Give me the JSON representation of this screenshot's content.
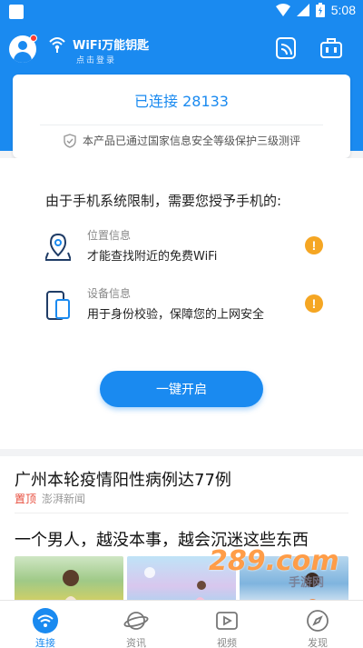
{
  "status_bar": {
    "time": "5:08"
  },
  "header": {
    "brand_name": "WiFi万能钥匙",
    "login_hint": "点击登录",
    "icons": [
      "avatar",
      "wifi-logo-icon",
      "scan-icon",
      "toolbox-icon"
    ]
  },
  "connection_card": {
    "status": "已连接 28133",
    "security_note": "本产品已通过国家信息安全等级保护三级测评"
  },
  "permissions": {
    "title": "由于手机系统限制，需要您授予手机的:",
    "items": [
      {
        "label": "位置信息",
        "description": "才能查找附近的免费WiFi",
        "icon": "location-icon"
      },
      {
        "label": "设备信息",
        "description": "用于身份校验，保障您的上网安全",
        "icon": "device-icon"
      }
    ],
    "enable_button": "一键开启"
  },
  "feed": {
    "items": [
      {
        "title": "广州本轮疫情阳性病例达77例",
        "pin": "置顶",
        "source": "澎湃新闻"
      },
      {
        "title": "一个男人，越没本事，越会沉迷这些东西"
      }
    ]
  },
  "watermark": {
    "main": "289.com",
    "sub": "手游网"
  },
  "tabs": [
    {
      "label": "连接",
      "icon": "wifi-icon",
      "active": true
    },
    {
      "label": "资讯",
      "icon": "planet-icon",
      "active": false
    },
    {
      "label": "视频",
      "icon": "video-icon",
      "active": false
    },
    {
      "label": "发现",
      "icon": "compass-icon",
      "active": false
    }
  ],
  "colors": {
    "primary": "#1a8af0",
    "warning": "#f5a623",
    "pin": "#e74c3c"
  }
}
